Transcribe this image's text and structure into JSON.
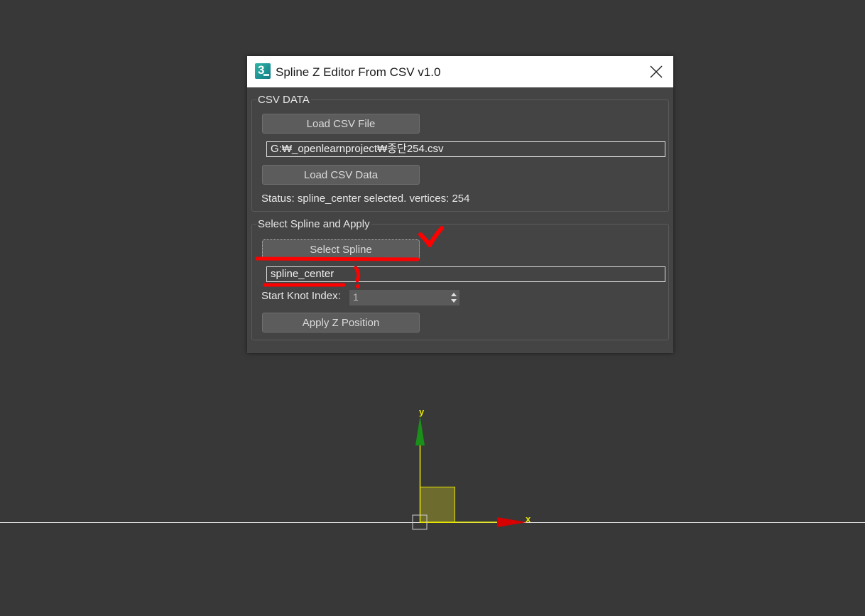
{
  "viewport": {
    "axis_y_label": "y",
    "axis_x_label": "x",
    "colors": {
      "background": "#383838",
      "gizmo_yellow": "#e8e800",
      "axis_green": "#1a8f1a",
      "axis_red": "#d60000"
    }
  },
  "dialog": {
    "icon": "3dsmax-app-icon",
    "icon_text": "3",
    "title": "Spline Z Editor From CSV v1.0",
    "close_icon": "close-icon",
    "csv_group": {
      "label": "CSV DATA",
      "load_file_button": "Load CSV File",
      "file_path": "G:₩_openlearnproject₩종단254.csv",
      "load_data_button": "Load CSV Data",
      "status": "Status: spline_center  selected. vertices: 254"
    },
    "apply_group": {
      "label": "Select Spline and Apply",
      "select_button": "Select Spline",
      "spline_name": "spline_center",
      "start_knot_label": "Start Knot Index:",
      "start_knot_value": "1",
      "apply_button": "Apply Z Position"
    }
  },
  "annotations": {
    "color": "#ff0000",
    "marks": [
      "checkmark",
      "underline-select-spline",
      "underline-spline-name",
      "exclamation-mark"
    ]
  }
}
